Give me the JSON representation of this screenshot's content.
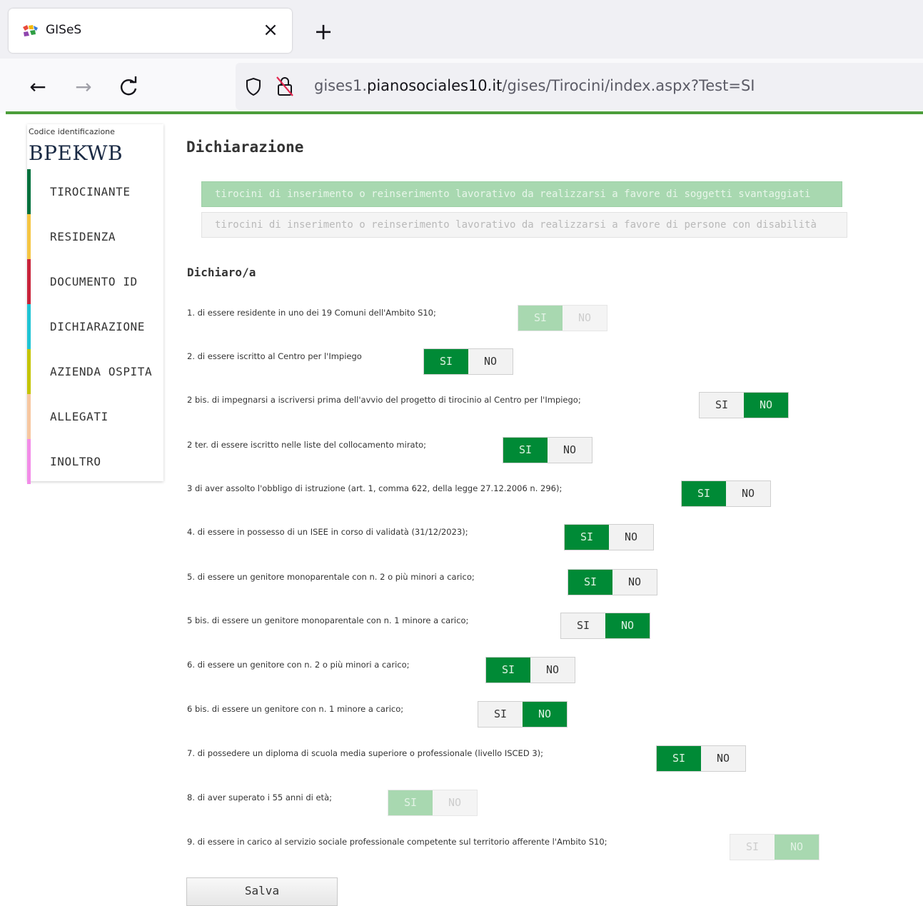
{
  "browser": {
    "tab_title": "GISeS",
    "close_glyph": "×",
    "new_tab_glyph": "+",
    "back_glyph": "←",
    "forward_glyph": "→",
    "reload_glyph": "C",
    "url_prefix": "gises1.",
    "url_host": "pianosociales10.it",
    "url_path": "/gises/Tirocini/index.aspx?Test=SI"
  },
  "sidebar": {
    "code_label": "Codice identificazione",
    "code_value": "BPEKWB",
    "items": [
      {
        "label": "TIROCINANTE",
        "color": "#00703c"
      },
      {
        "label": "RESIDENZA",
        "color": "#f5c542"
      },
      {
        "label": "DOCUMENTO ID",
        "color": "#c8233a"
      },
      {
        "label": "DICHIARAZIONE",
        "color": "#1fc4d4"
      },
      {
        "label": "AZIENDA OSPITA",
        "color": "#c4c400"
      },
      {
        "label": "ALLEGATI",
        "color": "#f7c7a0"
      },
      {
        "label": "INOLTRO",
        "color": "#f28ce8"
      }
    ]
  },
  "main": {
    "title": "Dichiarazione",
    "option_1": "tirocini di inserimento o reinserimento lavorativo da realizzarsi a favore di soggetti svantaggiati",
    "option_2": "tirocini di inserimento o reinserimento lavorativo da realizzarsi a favore di persone con disabilità",
    "section_label": "Dichiaro/a",
    "yes_label": "SI",
    "no_label": "NO",
    "questions": [
      {
        "text": "1. di essere residente in uno dei 19 Comuni dell'Ambito S10;",
        "selected": "SI",
        "disabled": true
      },
      {
        "text": "2. di essere iscritto al Centro per l'Impiego",
        "selected": "SI",
        "disabled": false
      },
      {
        "text": "2 bis. di impegnarsi a iscriversi prima dell'avvio del progetto di tirocinio al Centro per l'Impiego;",
        "selected": "NO",
        "disabled": false
      },
      {
        "text": "2 ter. di essere iscritto nelle liste del collocamento mirato;",
        "selected": "SI",
        "disabled": false
      },
      {
        "text": "3 di aver assolto l'obbligo di istruzione (art. 1, comma 622, della legge 27.12.2006 n. 296);",
        "selected": "SI",
        "disabled": false
      },
      {
        "text": "4. di essere in possesso di un ISEE in corso di validatà (31/12/2023);",
        "selected": "SI",
        "disabled": false
      },
      {
        "text": "5. di essere un genitore monoparentale con n. 2 o più minori a carico;",
        "selected": "SI",
        "disabled": false
      },
      {
        "text": "5 bis. di essere un genitore monoparentale con n. 1 minore a carico;",
        "selected": "NO",
        "disabled": false
      },
      {
        "text": "6. di essere un genitore con n. 2 o più minori a carico;",
        "selected": "SI",
        "disabled": false
      },
      {
        "text": "6 bis. di essere un genitore con n. 1 minore a carico;",
        "selected": "NO",
        "disabled": false
      },
      {
        "text": "7. di possedere un diploma di scuola media superiore o professionale (livello ISCED 3);",
        "selected": "SI",
        "disabled": false
      },
      {
        "text": "8. di aver superato i 55 anni di età;",
        "selected": "SI",
        "disabled": true
      },
      {
        "text": "9. di essere in carico al servizio sociale professionale competente sul territorio afferente l'Ambito S10;",
        "selected": "NO",
        "disabled": true
      }
    ],
    "save_label": "Salva"
  },
  "colors": {
    "accent_green": "#008a36",
    "disabled_green": "#a8d8b0",
    "browser_line": "#4c9e3a"
  }
}
